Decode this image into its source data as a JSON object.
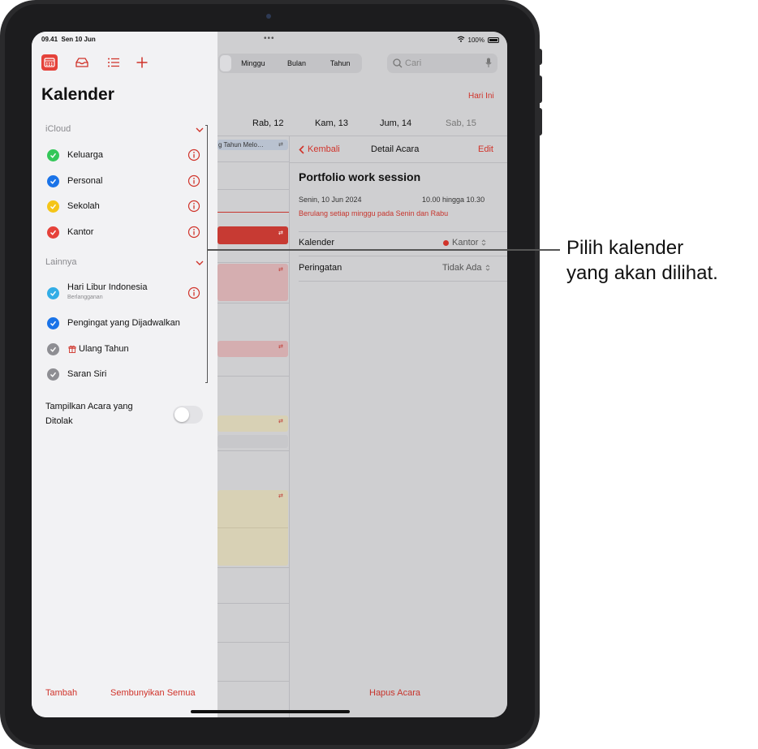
{
  "status": {
    "time": "09.41",
    "date": "Sen 10 Jun",
    "battery": "100%"
  },
  "toolbar": {
    "views": [
      "Minggu",
      "Bulan",
      "Tahun"
    ],
    "search_placeholder": "Cari",
    "today_label": "Hari Ini"
  },
  "week": {
    "days": [
      {
        "label": "l",
        "dim": false
      },
      {
        "label": "Rab, 12",
        "dim": false
      },
      {
        "label": "Kam, 13",
        "dim": false
      },
      {
        "label": "Jum, 14",
        "dim": false
      },
      {
        "label": "Sab, 15",
        "dim": true
      }
    ],
    "allday_event": "g Tahun Melo…"
  },
  "detail": {
    "back_label": "Kembali",
    "header_title": "Detail Acara",
    "edit_label": "Edit",
    "event_title": "Portfolio work session",
    "date": "Senin, 10 Jun 2024",
    "time": "10.00 hingga 10.30",
    "repeat": "Berulang setiap minggu pada Senin dan Rabu",
    "calendar_label": "Kalender",
    "calendar_value": "Kantor",
    "alert_label": "Peringatan",
    "alert_value": "Tidak Ada",
    "delete_label": "Hapus Acara"
  },
  "sidebar": {
    "title": "Kalender",
    "sections": [
      {
        "name": "iCloud",
        "items": [
          {
            "name": "Keluarga",
            "color": "#34c759"
          },
          {
            "name": "Personal",
            "color": "#1a73e8"
          },
          {
            "name": "Sekolah",
            "color": "#f5c518"
          },
          {
            "name": "Kantor",
            "color": "#e5423a"
          }
        ]
      },
      {
        "name": "Lainnya",
        "items": [
          {
            "name": "Hari Libur Indonesia",
            "sub": "Berlangganan",
            "color": "#32ade6"
          },
          {
            "name": "Pengingat yang Dijadwalkan",
            "color": "#1a73e8"
          },
          {
            "name": "Ulang Tahun",
            "color": "#8e8e93"
          },
          {
            "name": "Saran Siri",
            "color": "#8e8e93"
          }
        ]
      }
    ],
    "toggle_label": "Tampilkan Acara yang Ditolak",
    "add_label": "Tambah",
    "hide_all_label": "Sembunyikan Semua"
  },
  "callout": "Pilih kalender\nyang akan dilihat.",
  "colors": {
    "accent": "#d0332a"
  }
}
